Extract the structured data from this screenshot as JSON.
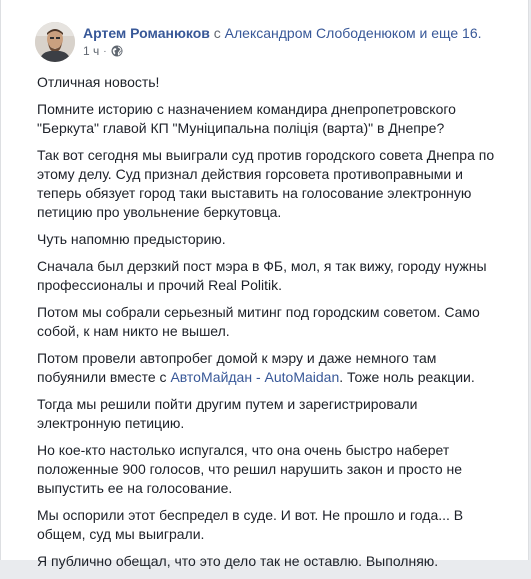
{
  "post": {
    "author": "Артем Романюков",
    "with_prefix": " с ",
    "tagged_person": "Александром Слободенюком",
    "and_others": " и еще 16.",
    "time": "1 ч",
    "dot": "·",
    "privacy_icon": "globe-icon",
    "paragraphs": {
      "p1": "Отличная новость!",
      "p2": "Помните историю с назначением командира днепропетровского \"Беркута\" главой КП \"Муніципальна поліція (варта)\" в Днепре?",
      "p3": "Так вот сегодня мы выиграли суд против городского совета Днепра по этому делу. Суд признал действия горсовета противоправными и теперь обязует город таки выставить на голосование электронную петицию про увольнение беркутовца.",
      "p4": "Чуть напомню предысторию.",
      "p5": "Сначала был дерзкий пост мэра в ФБ, мол, я так вижу, городу нужны профессионалы и прочий Real Politik.",
      "p6": "Потом мы собрали серьезный митинг под городским советом. Само собой, к нам никто не вышел.",
      "p7_before": "Потом провели автопробег домой к мэру и даже немного там побуянили вместе с ",
      "p7_link": "АвтоМайдан - AutoMaidan",
      "p7_after": ". Тоже ноль реакции.",
      "p8": "Тогда мы решили пойти другим путем и зарегистрировали электронную петицию.",
      "p9": "Но кое-кто настолько испугался, что она очень быстро наберет положенные 900 голосов, что решил нарушить закон и просто не выпустить ее на голосование.",
      "p10": "Мы оспорили этот беспредел в суде. И вот. Не прошло и года... В общем, суд мы выиграли.",
      "p11": "Я публично обещал, что это дело так не оставлю. Выполняю."
    }
  },
  "colors": {
    "link": "#385898",
    "text": "#1d2129",
    "meta": "#606770"
  }
}
